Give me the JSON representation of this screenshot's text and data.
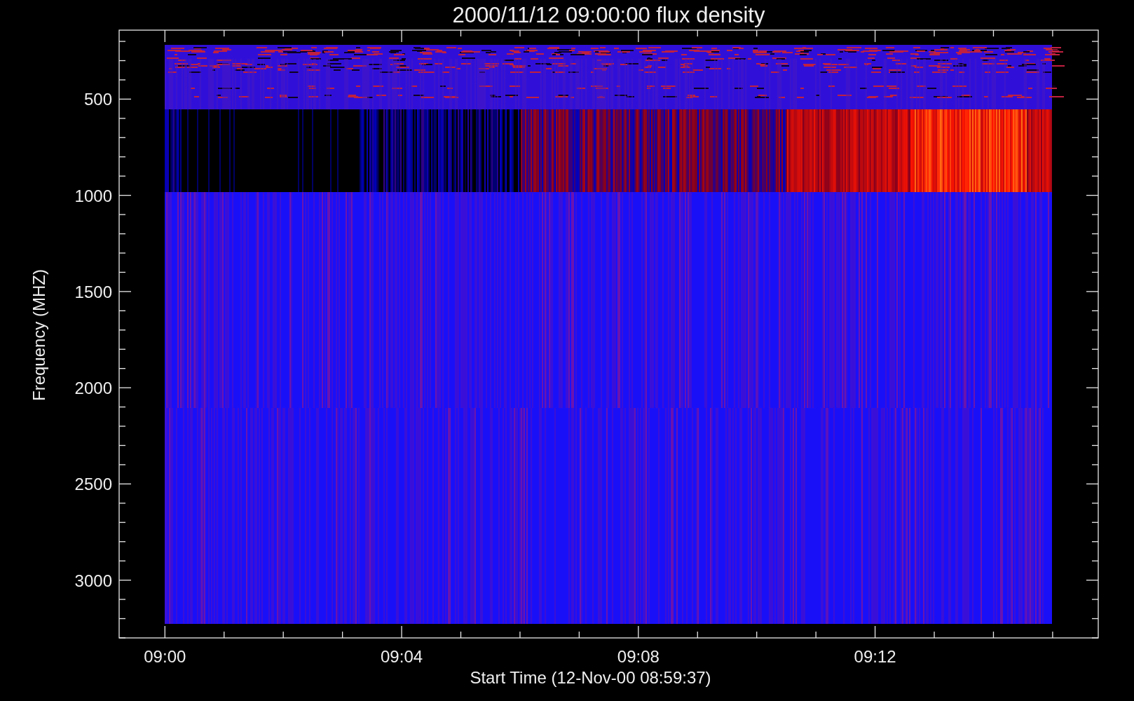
{
  "title": "2000/11/12 09:00:00 flux density",
  "y_axis": {
    "label": "Frequency (MHZ)",
    "tick_labels": [
      "500",
      "1000",
      "1500",
      "2000",
      "2500",
      "3000"
    ]
  },
  "x_axis": {
    "label": "Start Time (12-Nov-00 08:59:37)",
    "tick_labels": [
      "09:00",
      "09:04",
      "09:08",
      "09:12"
    ]
  }
}
